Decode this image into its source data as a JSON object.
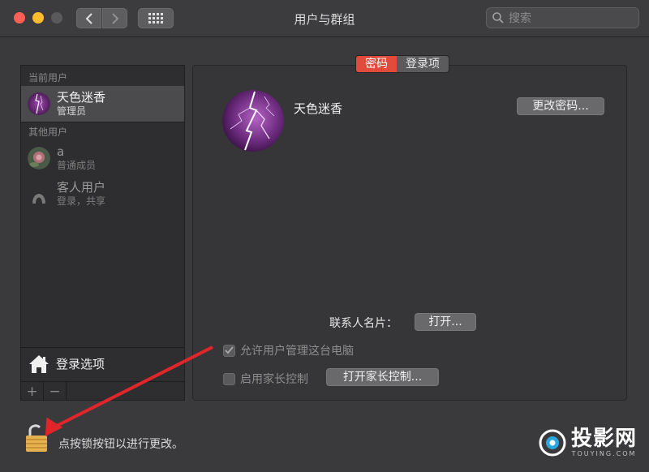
{
  "window": {
    "title": "用户与群组"
  },
  "search": {
    "placeholder": "搜索"
  },
  "sidebar": {
    "current_users_header": "当前用户",
    "current_user": {
      "name": "天色迷香",
      "role": "管理员"
    },
    "other_users_header": "其他用户",
    "other_users": [
      {
        "name": "a",
        "role": "普通成员"
      },
      {
        "name": "客人用户",
        "role": "登录，共享"
      }
    ],
    "login_options_label": "登录选项",
    "add_label": "+",
    "remove_label": "−"
  },
  "tabs": [
    {
      "label": "密码",
      "active": true
    },
    {
      "label": "登录项",
      "active": false
    }
  ],
  "main": {
    "user_name": "天色迷香",
    "change_password_button": "更改密码...",
    "contact_card_label": "联系人名片：",
    "open_button": "打开...",
    "allow_admin_label": "允许用户管理这台电脑",
    "allow_admin_checked": true,
    "parental_label": "启用家长控制",
    "parental_checked": false,
    "open_parental_button": "打开家长控制..."
  },
  "footer": {
    "lock_text": "点按锁按钮以进行更改。"
  },
  "watermark": {
    "brand": "投影网",
    "sub": "TOUYING.COM"
  },
  "colors": {
    "active_tab": "#e24a3c",
    "arrow": "#e0262a",
    "lock": "#e6b250"
  }
}
